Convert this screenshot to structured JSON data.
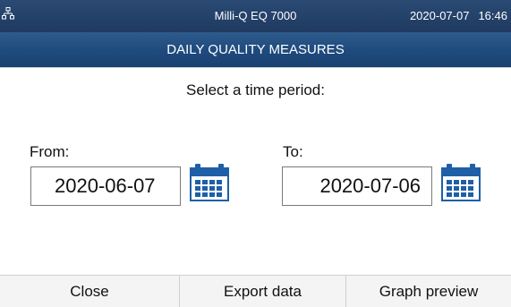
{
  "status": {
    "device_name": "Milli-Q EQ 7000",
    "date": "2020-07-07",
    "time": "16:46",
    "network_icon": "network-icon"
  },
  "title": "DAILY QUALITY MEASURES",
  "prompt": "Select a time period:",
  "from": {
    "label": "From:",
    "value": "2020-06-07",
    "icon": "calendar-icon"
  },
  "to": {
    "label": "To:",
    "value": "2020-07-06",
    "icon": "calendar-icon"
  },
  "buttons": {
    "close": "Close",
    "export": "Export data",
    "graph": "Graph preview"
  },
  "colors": {
    "header": "#1f4b7e",
    "calendar": "#1f5fa8"
  }
}
